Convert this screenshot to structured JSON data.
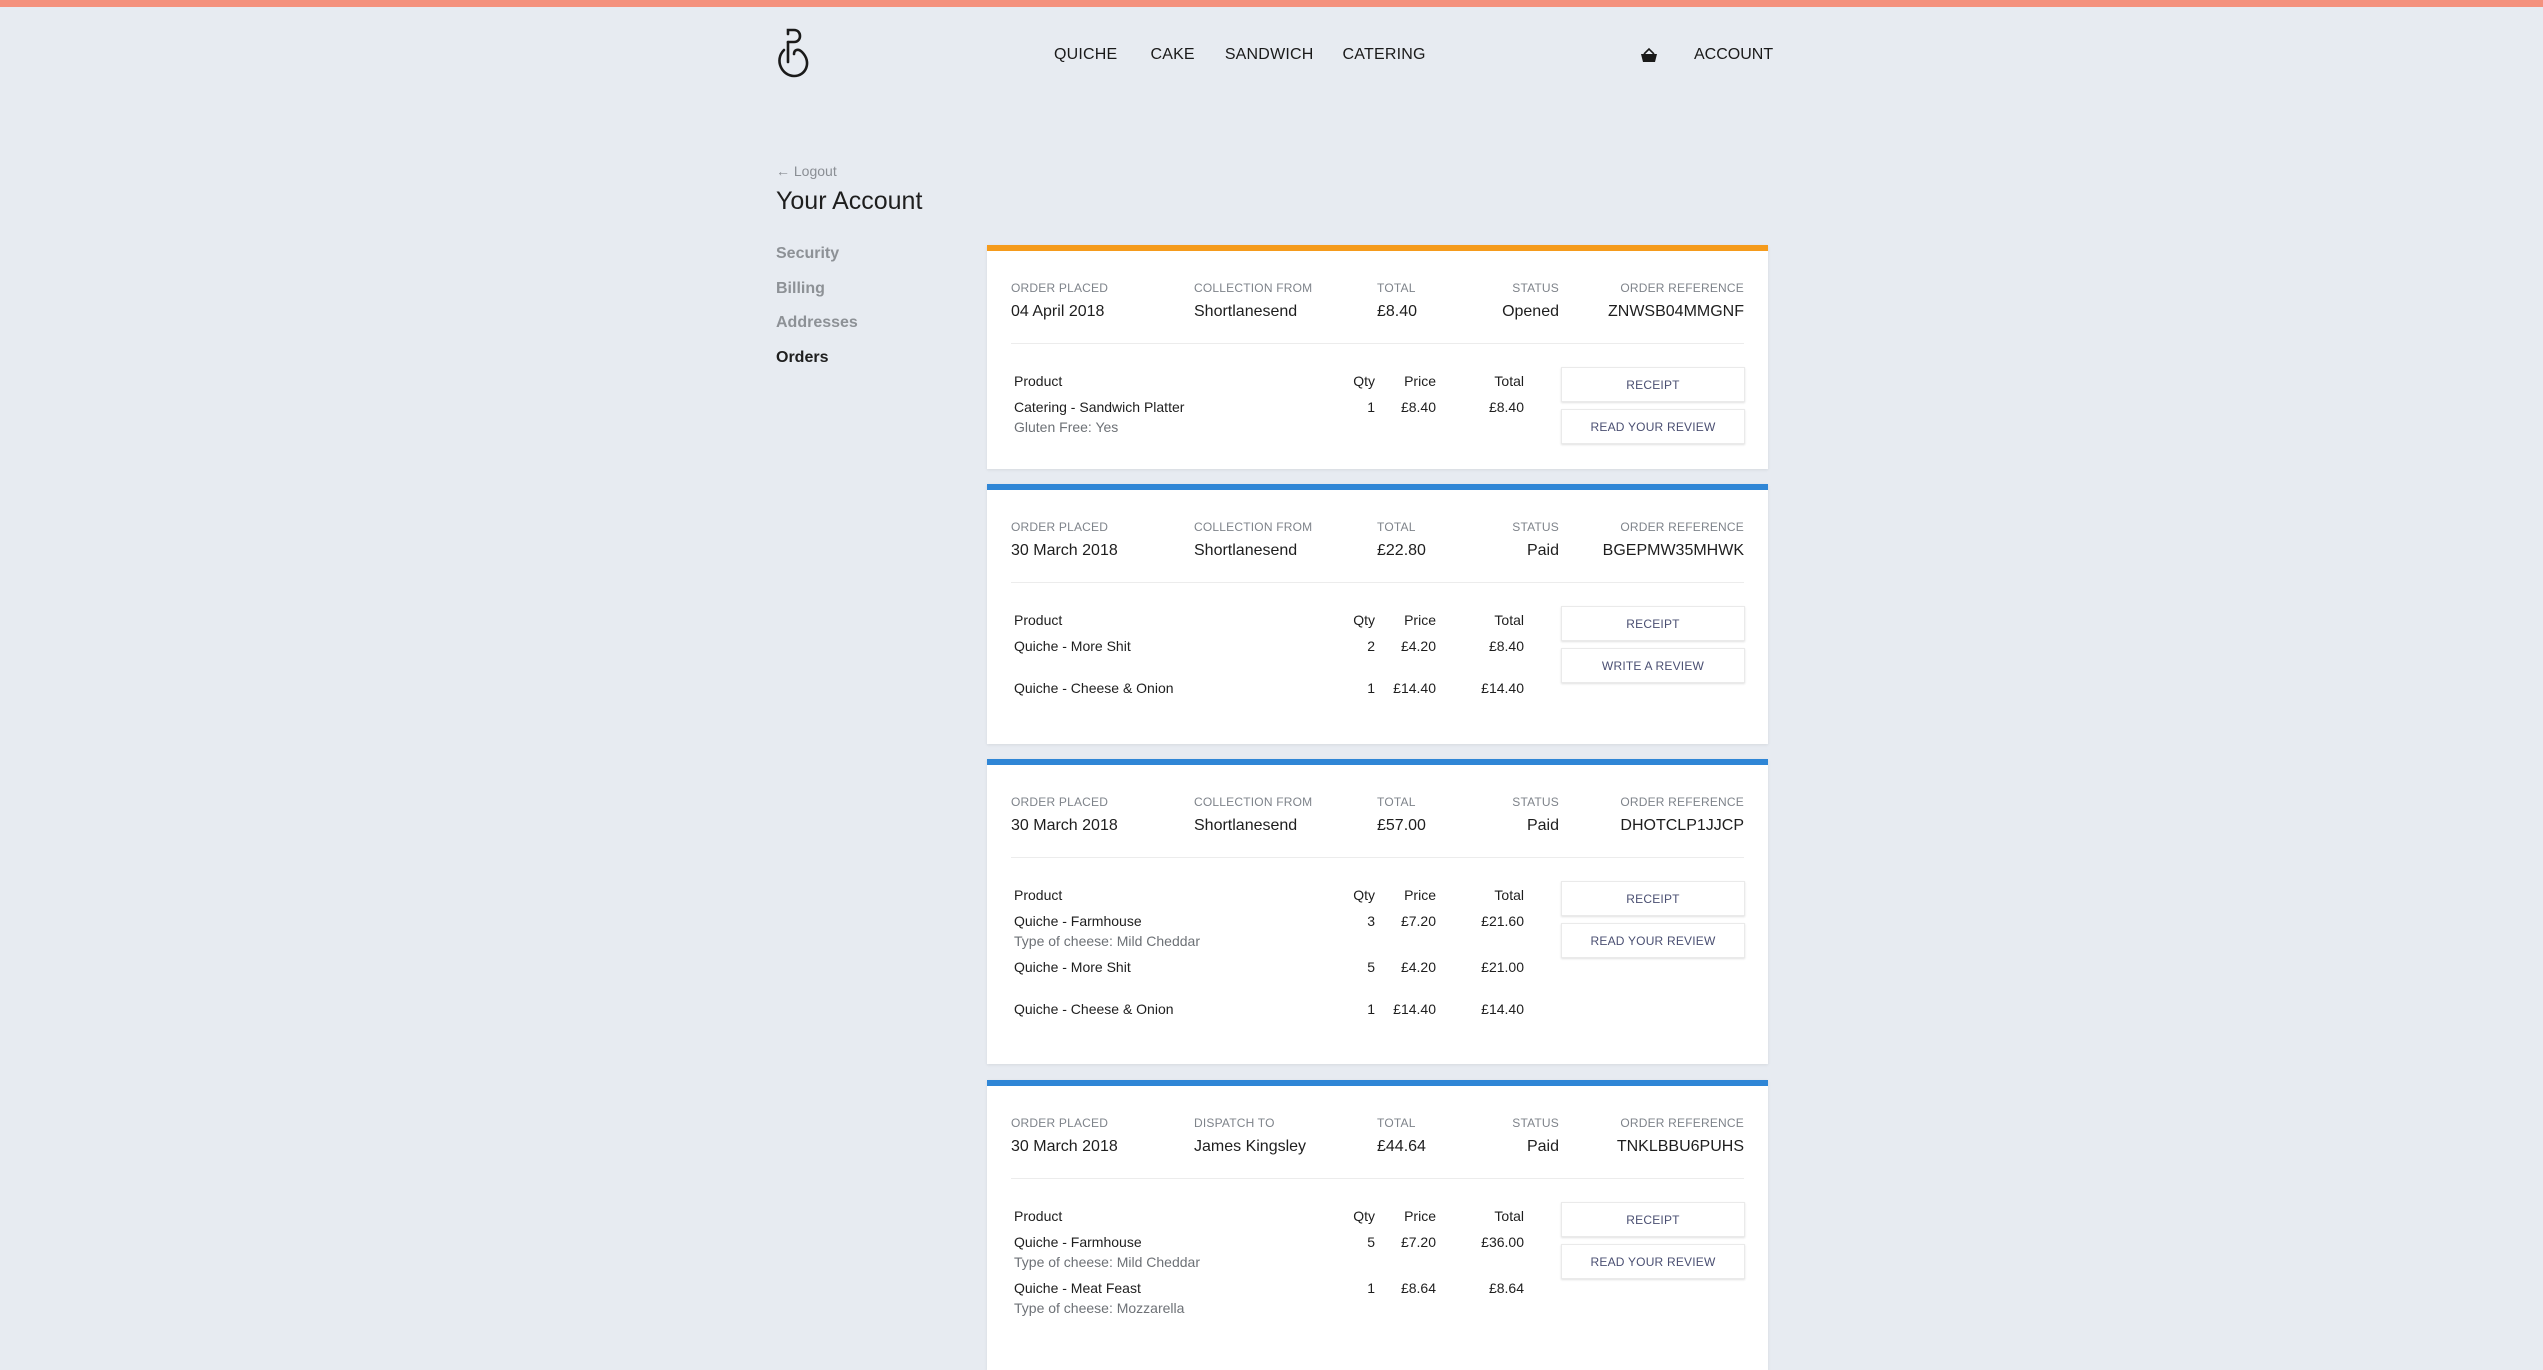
{
  "header": {
    "nav": [
      "QUICHE",
      "CAKE",
      "SANDWICH",
      "CATERING"
    ],
    "account_label": "ACCOUNT",
    "basket_icon": "basket-icon",
    "logo_icon": "logo-icon"
  },
  "account": {
    "logout_label": "← Logout",
    "title": "Your Account",
    "sidebar": [
      "Security",
      "Billing",
      "Addresses",
      "Orders"
    ],
    "active_item": "Orders"
  },
  "labels": {
    "order_placed": "ORDER PLACED",
    "total": "TOTAL",
    "status": "STATUS",
    "order_reference": "ORDER REFERENCE",
    "product": "Product",
    "qty": "Qty",
    "price": "Price",
    "line_total": "Total",
    "receipt": "RECEIPT"
  },
  "colors": {
    "accent_top": "#f4917d",
    "stripe_opened": "#f59b1c",
    "stripe_paid": "#2f86d6"
  },
  "orders": [
    {
      "placed": "04 April 2018",
      "location_label": "COLLECTION FROM",
      "location": "Shortlanesend",
      "total": "£8.40",
      "status": "Opened",
      "reference": "ZNWSB04MMGNF",
      "review_label": "READ YOUR REVIEW",
      "items": [
        {
          "product": "Catering - Sandwich Platter",
          "option": "Gluten Free: Yes",
          "qty": "1",
          "price": "£8.40",
          "total": "£8.40"
        }
      ]
    },
    {
      "placed": "30 March 2018",
      "location_label": "COLLECTION FROM",
      "location": "Shortlanesend",
      "total": "£22.80",
      "status": "Paid",
      "reference": "BGEPMW35MHWK",
      "review_label": "WRITE A REVIEW",
      "items": [
        {
          "product": "Quiche - More Shit",
          "option": "",
          "qty": "2",
          "price": "£4.20",
          "total": "£8.40"
        },
        {
          "product": "Quiche - Cheese & Onion",
          "option": "",
          "qty": "1",
          "price": "£14.40",
          "total": "£14.40"
        }
      ]
    },
    {
      "placed": "30 March 2018",
      "location_label": "COLLECTION FROM",
      "location": "Shortlanesend",
      "total": "£57.00",
      "status": "Paid",
      "reference": "DHOTCLP1JJCP",
      "review_label": "READ YOUR REVIEW",
      "items": [
        {
          "product": "Quiche - Farmhouse",
          "option": "Type of cheese: Mild Cheddar",
          "qty": "3",
          "price": "£7.20",
          "total": "£21.60"
        },
        {
          "product": "Quiche - More Shit",
          "option": "",
          "qty": "5",
          "price": "£4.20",
          "total": "£21.00"
        },
        {
          "product": "Quiche - Cheese & Onion",
          "option": "",
          "qty": "1",
          "price": "£14.40",
          "total": "£14.40"
        }
      ]
    },
    {
      "placed": "30 March 2018",
      "location_label": "DISPATCH TO",
      "location": "James Kingsley",
      "total": "£44.64",
      "status": "Paid",
      "reference": "TNKLBBU6PUHS",
      "review_label": "READ YOUR REVIEW",
      "items": [
        {
          "product": "Quiche - Farmhouse",
          "option": "Type of cheese: Mild Cheddar",
          "qty": "5",
          "price": "£7.20",
          "total": "£36.00"
        },
        {
          "product": "Quiche - Meat Feast",
          "option": "Type of cheese: Mozzarella",
          "qty": "1",
          "price": "£8.64",
          "total": "£8.64"
        }
      ]
    }
  ]
}
